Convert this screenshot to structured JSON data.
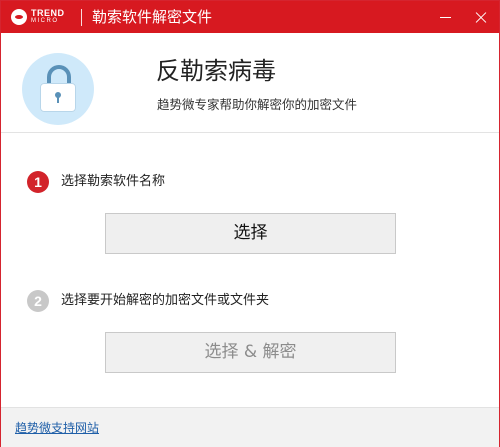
{
  "titlebar": {
    "logo_line1": "TREND",
    "logo_line2": "MICRO",
    "title": "勒索软件解密文件",
    "minimize_icon": "minimize-icon",
    "close_icon": "close-icon"
  },
  "header": {
    "icon": "lock-icon",
    "title": "反勒索病毒",
    "subtitle": "趋势微专家帮助你解密你的加密文件"
  },
  "steps": [
    {
      "number": "1",
      "label": "选择勒索软件名称",
      "button_label": "选择",
      "active": true
    },
    {
      "number": "2",
      "label": "选择要开始解密的加密文件或文件夹",
      "button_label": "选择 & 解密",
      "active": false
    }
  ],
  "footer": {
    "support_link": "趋势微支持网站"
  },
  "colors": {
    "brand_red": "#d71920",
    "step_active": "#d2232a",
    "step_inactive": "#c8c8c8",
    "link": "#1f5fa8"
  }
}
